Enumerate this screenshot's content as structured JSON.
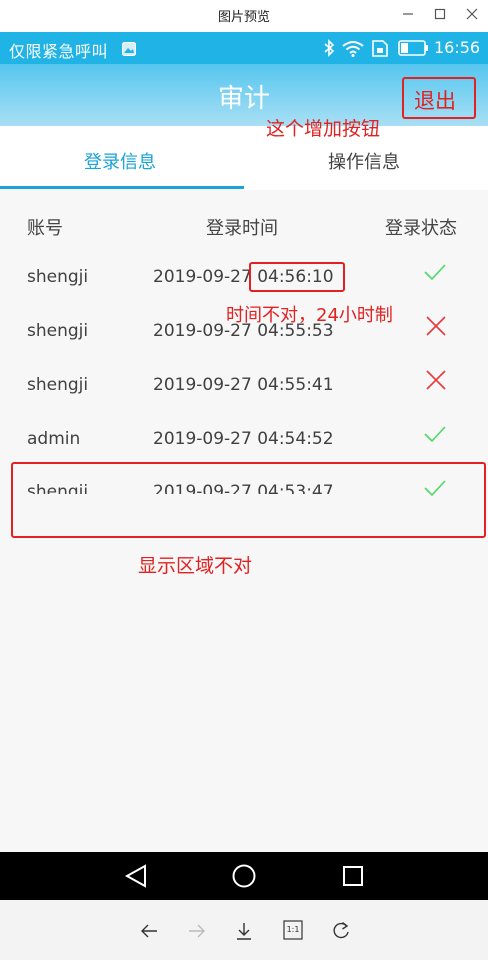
{
  "viewer": {
    "title": "图片预览",
    "toolbar": {
      "one_to_one": "1:1"
    }
  },
  "status_bar": {
    "notification_text": "仅限紧急呼叫",
    "time": "16:56"
  },
  "header": {
    "title": "审计",
    "logout_label": "退出"
  },
  "tabs": [
    {
      "label": "登录信息",
      "active": true
    },
    {
      "label": "操作信息",
      "active": false
    }
  ],
  "table": {
    "columns": [
      "账号",
      "登录时间",
      "登录状态"
    ],
    "rows": [
      {
        "account": "shengji",
        "time": "2019-09-27  04:56:10",
        "status": "success"
      },
      {
        "account": "shengji",
        "time": "2019-09-27  04:55:53",
        "status": "failure"
      },
      {
        "account": "shengji",
        "time": "2019-09-27  04:55:41",
        "status": "failure"
      },
      {
        "account": "admin",
        "time": "2019-09-27  04:54:52",
        "status": "success"
      },
      {
        "account": "shengji",
        "time": "2019-09-27  04:53:47",
        "status": "success"
      }
    ]
  },
  "annotations": {
    "add_button_note": "这个增加按钮",
    "time_note": "时间不对，24小时制",
    "display_area_note": "显示区域不对"
  },
  "colors": {
    "accent": "#1aa3d6",
    "status_bar": "#20b3e6",
    "success": "#4cd964",
    "failure": "#e8373a",
    "annotation": "#e22222"
  }
}
